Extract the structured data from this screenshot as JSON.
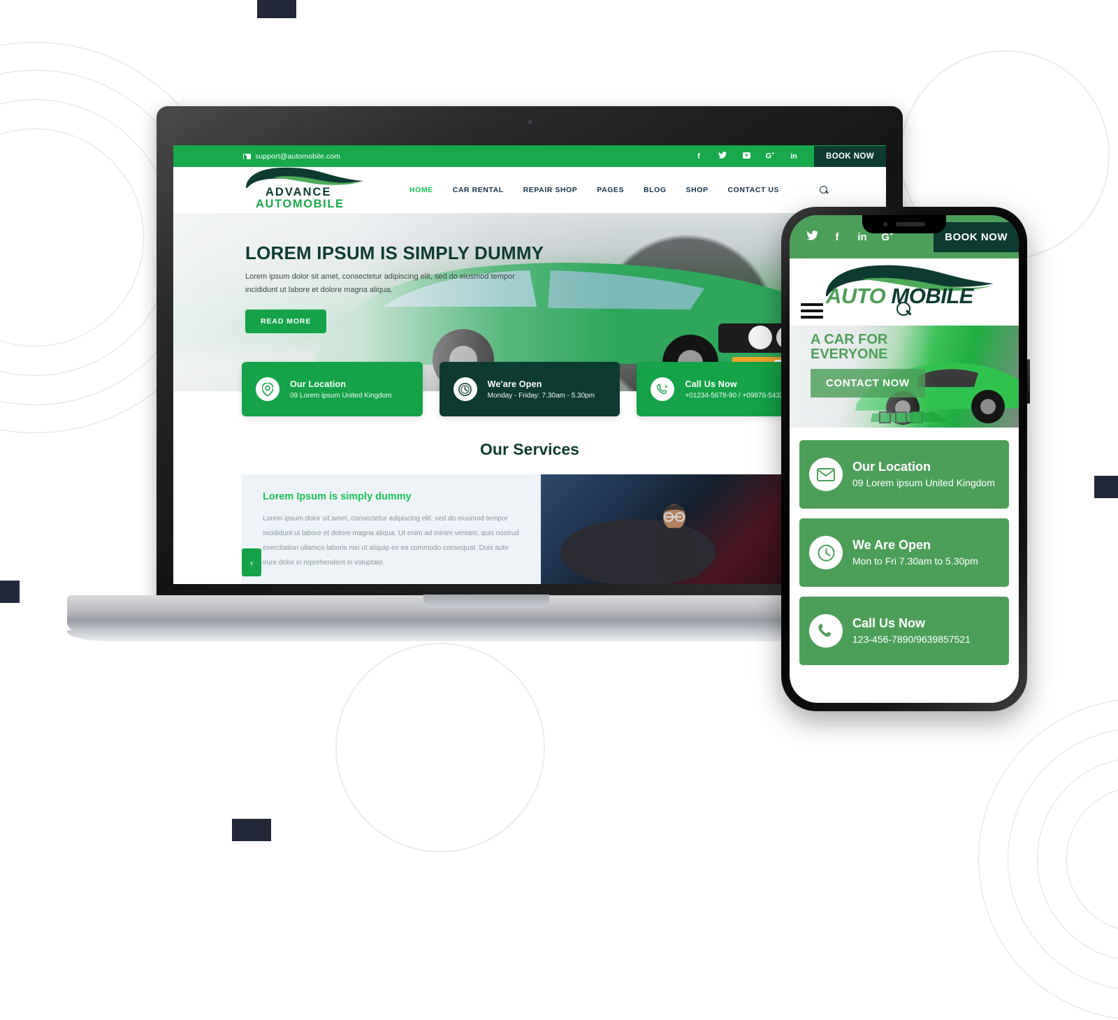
{
  "desktop": {
    "topbar": {
      "email": "support@automobile.com",
      "email_icon": "envelope-icon",
      "socials": [
        {
          "name": "facebook-icon",
          "glyph": "f"
        },
        {
          "name": "twitter-icon",
          "glyph": "⚑"
        },
        {
          "name": "youtube-icon",
          "glyph": "▶"
        },
        {
          "name": "google-plus-icon",
          "glyph": "G+"
        },
        {
          "name": "linkedin-icon",
          "glyph": "in"
        }
      ],
      "book_now": "BOOK NOW",
      "bg_color": "#17a94a",
      "book_bg_color": "#0d3b31"
    },
    "header": {
      "logo_line1": "ADVANCE",
      "logo_line2": "AUTOMOBILE",
      "search_icon": "search-icon",
      "nav": [
        {
          "label": "HOME",
          "active": true
        },
        {
          "label": "CAR RENTAL",
          "active": false
        },
        {
          "label": "REPAIR SHOP",
          "active": false
        },
        {
          "label": "PAGES",
          "active": false
        },
        {
          "label": "BLOG",
          "active": false
        },
        {
          "label": "SHOP",
          "active": false
        },
        {
          "label": "CONTACT US",
          "active": false
        }
      ]
    },
    "hero": {
      "title": "LOREM IPSUM IS SIMPLY DUMMY",
      "subtitle": "Lorem ipsum dolor sit amet, consectetur adipiscing elit, sed do eiusmod tempor incididunt ut labore et dolore magna aliqua.",
      "cta": "READ MORE",
      "prev_arrow": "‹"
    },
    "info_cards": [
      {
        "icon": "map-pin-icon",
        "title": "Our Location",
        "subtitle": "09 Lorem ipsum United Kingdom",
        "theme": "green"
      },
      {
        "icon": "clock-icon",
        "title": "We'are Open",
        "subtitle": "Monday - Friday: 7.30am - 5.30pm",
        "theme": "dark"
      },
      {
        "icon": "phone-ring-icon",
        "title": "Call Us Now",
        "subtitle": "+01234-5678-90  /  +09876-5432-10",
        "theme": "green"
      }
    ],
    "services": {
      "heading": "Our Services",
      "card_title": "Lorem Ipsum is simply dummy",
      "card_text": "Lorem ipsum dolor sit amet, consectetur adipiscing elit, sed do eiusmod tempor incididunt ut labore et dolore magna aliqua. Ut enim ad minim veniam, quis nostrud exercitation ullamco laboris nisi ut aliquip ex ea commodo consequat. Duis aute irure dolor in reprehenderit in voluptate.",
      "prev_arrow": "‹"
    }
  },
  "mobile": {
    "topbar": {
      "socials": [
        {
          "name": "twitter-icon",
          "glyph": "⚑"
        },
        {
          "name": "facebook-icon",
          "glyph": "f"
        },
        {
          "name": "linkedin-icon",
          "glyph": "in"
        },
        {
          "name": "google-plus-icon",
          "glyph": "G+"
        }
      ],
      "book_now": "BOOK NOW",
      "bg_color": "#4d9f58"
    },
    "header": {
      "logo_part1": "AUTO",
      "logo_part2": " MOBILE",
      "menu_icon": "hamburger-menu-icon",
      "search_icon": "search-icon"
    },
    "hero": {
      "title_line1": "A CAR FOR",
      "title_line2": "EVERYONE",
      "cta": "CONTACT NOW",
      "dots": 3,
      "active_dot": 3
    },
    "cards": [
      {
        "icon": "envelope-icon",
        "title": "Our Location",
        "subtitle": "09 Lorem ipsum United Kingdom"
      },
      {
        "icon": "clock-icon",
        "title": "We Are Open",
        "subtitle": "Mon to Fri 7.30am to 5.30pm"
      },
      {
        "icon": "phone-icon",
        "title": "Call Us Now",
        "subtitle": "123-456-7890/9639857521"
      }
    ]
  },
  "theme": {
    "accent_green": "#17a94a",
    "mobile_green": "#4d9f58",
    "dark_teal": "#0d3b31",
    "navy_square": "#222838",
    "ring_gray": "#e3e3e3"
  }
}
